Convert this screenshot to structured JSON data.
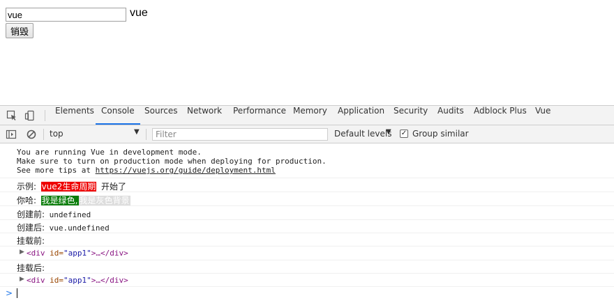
{
  "page": {
    "input_value": "vue",
    "echo_text": "vue",
    "destroy_button": "销毁"
  },
  "devtools": {
    "tabs": [
      "Elements",
      "Console",
      "Sources",
      "Network",
      "Performance",
      "Memory",
      "Application",
      "Security",
      "Audits",
      "Adblock Plus",
      "Vue"
    ],
    "active_tab": "Console",
    "toolbar": {
      "context": "top",
      "filter_placeholder": "Filter",
      "levels": "Default levels",
      "group_similar": "Group similar",
      "group_similar_checked": true
    }
  },
  "console": {
    "dev_notice": {
      "line1": "You are running Vue in development mode.",
      "line2": "Make sure to turn on production mode when deploying for production.",
      "line3_prefix": "See more tips at ",
      "line3_link": "https://vuejs.org/guide/deployment.html"
    },
    "example": {
      "label": "示例:",
      "badge": "vue2生命周期",
      "suffix": "开始了"
    },
    "hello": {
      "label": "你哈:",
      "green": "我是绿色,",
      "gray": "我是灰色背景"
    },
    "before_create": {
      "label": "创建前:",
      "value": "undefined"
    },
    "created": {
      "label": "创建后:",
      "value": "vue.undefined"
    },
    "before_mount": {
      "label": "挂载前:"
    },
    "element1": {
      "open": "<div",
      "attr": " id=",
      "value": "\"app1\"",
      "close": ">…</div>"
    },
    "mounted": {
      "label": "挂载后:"
    },
    "element2": {
      "open": "<div",
      "attr": " id=",
      "value": "\"app1\"",
      "close": ">…</div>"
    },
    "prompt": ">"
  }
}
